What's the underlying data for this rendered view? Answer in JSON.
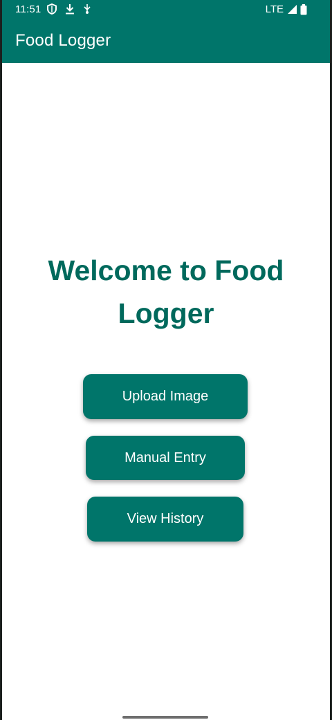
{
  "status_bar": {
    "time": "11:51",
    "left_icons": [
      "shield-icon",
      "download-icon",
      "usb-icon"
    ],
    "network": "LTE",
    "right_icons": [
      "signal-icon",
      "battery-icon"
    ]
  },
  "app_bar": {
    "title": "Food Logger"
  },
  "main": {
    "heading": "Welcome to Food Logger",
    "buttons": [
      {
        "label": "Upload Image"
      },
      {
        "label": "Manual Entry"
      },
      {
        "label": "View History"
      }
    ]
  },
  "colors": {
    "primary": "#00756a",
    "heading": "#00695c",
    "background": "#ffffff"
  }
}
